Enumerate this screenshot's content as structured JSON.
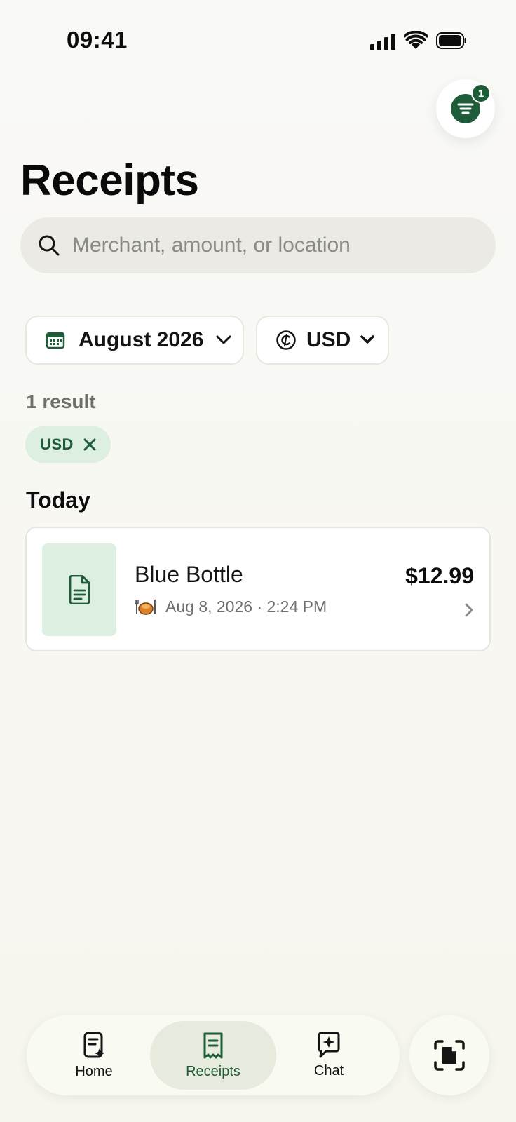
{
  "status_bar": {
    "time": "09:41"
  },
  "filter_button": {
    "badge_count": "1"
  },
  "page": {
    "title": "Receipts"
  },
  "search": {
    "placeholder": "Merchant, amount, or location",
    "value": ""
  },
  "filters": {
    "date": {
      "label": "August 2026"
    },
    "currency": {
      "label": "USD"
    }
  },
  "results": {
    "count_label": "1 result"
  },
  "active_tags": [
    {
      "label": "USD"
    }
  ],
  "sections": [
    {
      "label": "Today",
      "receipts": [
        {
          "merchant": "Blue Bottle",
          "date_time": "Aug 8, 2026 · 2:24 PM",
          "amount": "$12.99",
          "category_icon": "dining-icon"
        }
      ]
    }
  ],
  "bottom_nav": {
    "items": [
      {
        "label": "Home",
        "icon": "home-receipt-icon"
      },
      {
        "label": "Receipts",
        "icon": "receipt-icon",
        "active": true
      },
      {
        "label": "Chat",
        "icon": "chat-sparkle-icon"
      }
    ],
    "scan_icon": "scan-document-icon"
  },
  "colors": {
    "accent": "#1f5c3a",
    "accent_light": "#dcefe0",
    "background": "#f8f7f2"
  }
}
